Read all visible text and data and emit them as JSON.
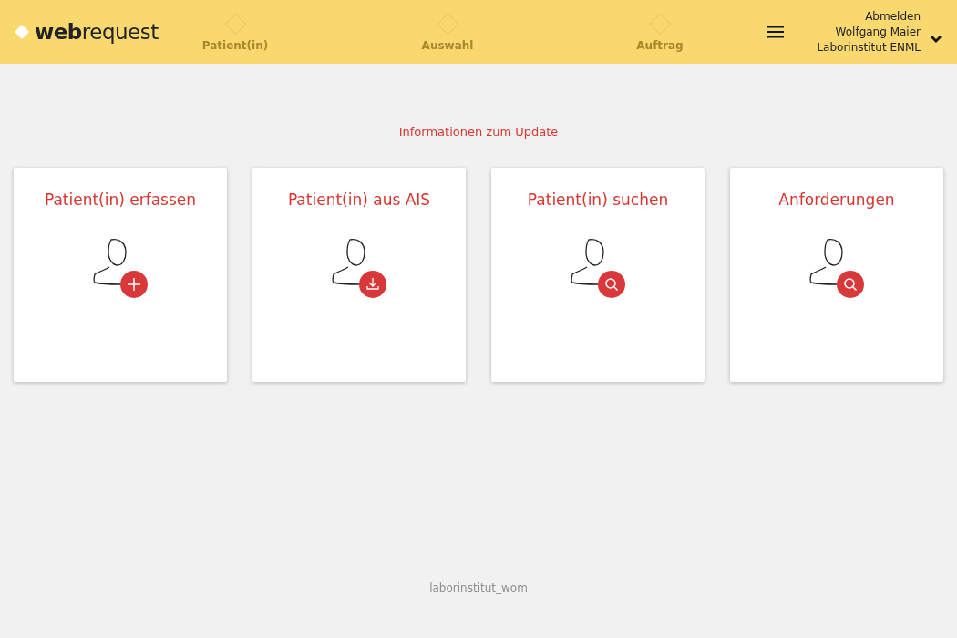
{
  "header": {
    "logo": "**web**request",
    "steps": [
      {
        "label": "Patient(in)"
      },
      {
        "label": "Auswahl"
      },
      {
        "label": "Auftrag"
      }
    ],
    "user": {
      "logout": "Abmelden",
      "name": "Wolfgang Maier",
      "institute": "Laborinstitut ENML"
    }
  },
  "update_link": "Informationen zum Update",
  "cards": [
    {
      "title": "Patient(in) erfassen",
      "kind": "add"
    },
    {
      "title": "Patient(in) aus AIS",
      "kind": "import"
    },
    {
      "title": "Patient(in) suchen",
      "kind": "search"
    },
    {
      "title": "Anforderungen",
      "kind": "search"
    }
  ],
  "footer": "laborinstitut_wom"
}
